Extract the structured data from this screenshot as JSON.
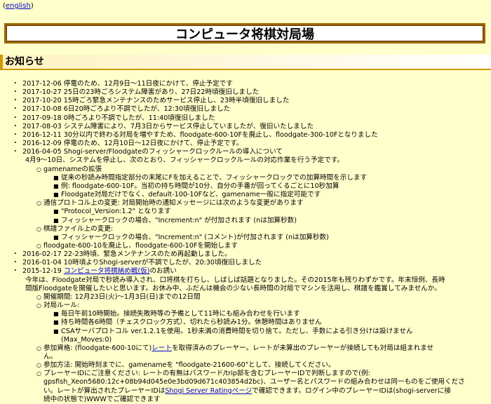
{
  "lang_link": "english",
  "title": "コンピュータ将棋対局場",
  "section_title": "お知らせ",
  "news": [
    "2017-12-06 停電のため、12月9日～11日夜にかけて、停止予定です",
    "2017-10-27 25日の23時ごろシステム障害があり、27日22時頃復旧しました",
    "2017-10-20 15時ごろ緊急メンテナンスのためサービス停止し、23時半頃復旧しました",
    "2017-10-08 6日20時ごろより不調でしたが、12:30頃復旧しました",
    "2017-09-18 0時ごろより不調でしたが、11:40頃復旧しました",
    "2017-08-03 システム障害により、7月3日からサービス停止していましたが、復旧いたしました",
    "2016-12-11 30分以内で終わる対局を増やすため、floodgate-600-10Fを廃止し、floodgate-300-10Fとなりました",
    "2016-12-09 停電のため、12月10日～12日夜にかけて、停止予定です。"
  ],
  "news_2016_04": {
    "head": "2016-04-05 Shogi-server/Floodgateのフィッシャークロックルールの導入について",
    "intro": "4月9～10日、システムを停止し、次のとおり、フィッシャークロックルールの対応作業を行う予定です。",
    "gamename": {
      "label": "gamenameの拡張",
      "items": [
        "従来の秒読み時間指定部分の末尾にFを加えることで、フィッシャークロックでの加算時間を示します",
        "例: floodgate-600-10F。当初の持ち時間が10分、自分の手番が回ってくるごとに10秒加算",
        "Floodgate対局だけでなく、default-100-10Fなど、gamename一般に指定可能です"
      ]
    },
    "protocol": {
      "label": "通信プロトコル上の変更: 対局開始時の通知メッセージには次のような変更があります",
      "items": [
        "\"Protocol_Version:1.2\" となります",
        "フィッシャークロックの場合、\"Increment:n\" が付加されます (nは加算秒数)"
      ]
    },
    "kifu": {
      "label": "棋譜ファイル上の変更:",
      "items": [
        "フィッシャークロックの場合、\"Increment:n\" (コメント)が付加されます (nは加算秒数)"
      ]
    },
    "floodgate_change": "floodgate-600-10を廃止し、floodgate-600-10Fを開始します"
  },
  "news_after": [
    "2016-02-17 22-23時頃、緊急メンテナンスのため再起動しました。",
    "2016-01-04 10時頃よりShogi-serverが不調でしたが、20:30頃復旧しました"
  ],
  "news_2015": {
    "date": "2015-12-19",
    "link": "コンピュータ将棋納め戦(仮)",
    "suffix": "のお誘い",
    "para1": "今年は、Floodgate対局で秒読み導入され、口将棋を打ちし、しばしば話題となりました。その2015年も残りわずかです。年末恒例、長時",
    "para2": "間版Floodgateを開催したいと思います。お休み中、ふだんは機会の少ない長時間の対局でマシンを活用し、棋譜を鑑賞してみませんか。",
    "period": "開催期間: 12月23日(火)～1月3日(日)までの12日間",
    "rules_label": "対局ルール:",
    "rules": [
      "毎日午前10時開始。接続失敗時等の予備として11時にも組み合わせを行います",
      "持ち時間各6時間（チェスクロック方式）、切れたら秒読み1分。休憩時間はありません",
      "CSAサーバプロトコル ver.1.2.1を使用。1秒未満の消費時間を切り捨て。ただし、手数による引き分けは設けません",
      "(Max_Moves:0)"
    ],
    "qual_prefix": "参加資格: (floodgate-600-10にて)",
    "qual_link": "レート",
    "qual_suffix": "を取得済みのプレーヤー。レートが未算出のプレーヤーが接続しても対局は組まれませ",
    "qual_cont": "ん。",
    "how": "参加方法: 開始時刻までに、gamenameを \"floodgate-21600-60\"として、接続してください。",
    "id_note1": "プレーヤーIDにご注意ください: レートの有無はパスワード/trip部を含むプレーヤーIDで判断しますので(例:",
    "id_note2_prefix": "gpsfish_Xeon5680:12c+08b94d045e0e3bd09d671c403854d2bc)、ユーザー名とパスワードの組み合わせは同一ものをご使用くださ",
    "id_note3_prefix": "い。レートが算出されたプレーヤーIDは",
    "id_note3_link": "Shogi Server Ratingページ",
    "id_note3_suffix": "で確認できます。ログイン中のプレーヤーIDは(shogi-serverに接",
    "id_note4": "続中の状態で)WWWでご確認できます"
  }
}
